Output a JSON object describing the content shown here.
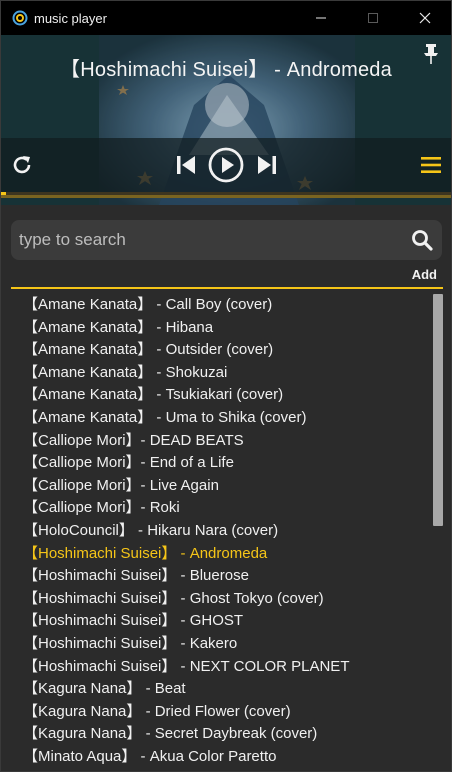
{
  "window": {
    "title": "music player"
  },
  "player": {
    "current_title": "【Hoshimachi Suisei】 - Andromeda",
    "progress_fraction": 0.01,
    "accent_color": "#f5c518",
    "icons": [
      "pin-icon",
      "repeat-icon",
      "previous-icon",
      "play-icon",
      "next-icon",
      "menu-icon"
    ]
  },
  "search": {
    "placeholder": "type to search",
    "value": ""
  },
  "playlist": {
    "add_label": "Add",
    "active_index": 11,
    "tracks": [
      "【Amane Kanata】 - Call Boy (cover)",
      "【Amane Kanata】 - Hibana",
      "【Amane Kanata】 - Outsider (cover)",
      "【Amane Kanata】 - Shokuzai",
      "【Amane Kanata】 - Tsukiakari (cover)",
      "【Amane Kanata】 - Uma to Shika (cover)",
      "【Calliope Mori】- DEAD BEATS",
      "【Calliope Mori】- End of a Life",
      "【Calliope Mori】- Live Again",
      "【Calliope Mori】- Roki",
      "【HoloCouncil】 - Hikaru Nara (cover)",
      "【Hoshimachi Suisei】 - Andromeda",
      "【Hoshimachi Suisei】 - Bluerose",
      "【Hoshimachi Suisei】 - Ghost Tokyo (cover)",
      "【Hoshimachi Suisei】 - GHOST",
      "【Hoshimachi Suisei】 - Kakero",
      "【Hoshimachi Suisei】 - NEXT COLOR PLANET",
      "【Kagura Nana】 - Beat",
      "【Kagura Nana】 - Dried Flower (cover)",
      "【Kagura Nana】 - Secret Daybreak (cover)",
      "【Minato Aqua】 - Akua Color Paretto"
    ]
  }
}
